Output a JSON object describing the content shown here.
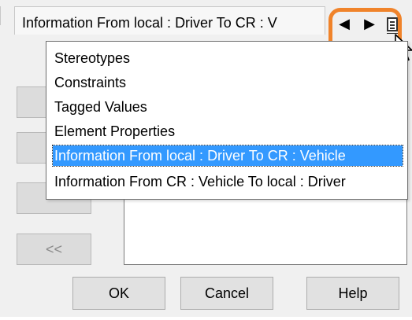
{
  "tab": {
    "title": "Information From local : Driver To CR : V",
    "nav_prev": "◀",
    "nav_next": "▶",
    "menu_icon": "list-menu-icon"
  },
  "dropdown": {
    "items": [
      {
        "label": "Stereotypes",
        "selected": false
      },
      {
        "label": "Constraints",
        "selected": false
      },
      {
        "label": "Tagged Values",
        "selected": false
      },
      {
        "label": "Element Properties",
        "selected": false
      },
      {
        "label": "Information From local : Driver To CR : Vehicle",
        "selected": true
      },
      {
        "label": "Information From CR : Vehicle To local : Driver",
        "selected": false
      }
    ]
  },
  "side_buttons": {
    "move_left_label": "<<"
  },
  "footer": {
    "ok_label": "OK",
    "cancel_label": "Cancel",
    "help_label": "Help"
  },
  "colors": {
    "highlight": "#f0832a",
    "selection": "#3399ff"
  }
}
